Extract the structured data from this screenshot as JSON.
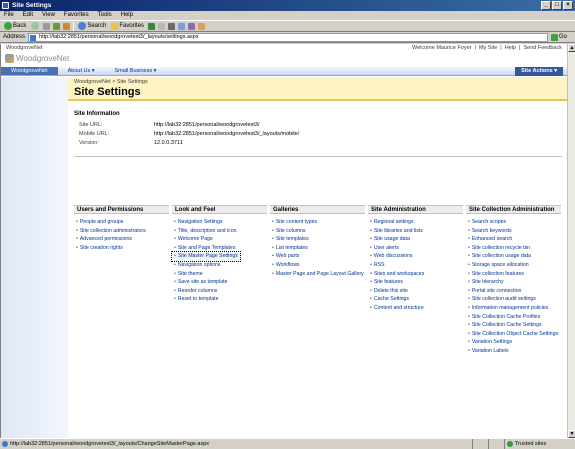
{
  "window": {
    "title": "Site Settings"
  },
  "menu": [
    "File",
    "Edit",
    "View",
    "Favorites",
    "Tools",
    "Help"
  ],
  "toolbar": {
    "back": "Back",
    "search": "Search",
    "favorites": "Favorites"
  },
  "address": {
    "label": "Address",
    "url": "http://lab32:2851/personal/woodgrovetest3/_layouts/settings.aspx",
    "go": "Go"
  },
  "sp": {
    "site_name": "WoodgroveNet",
    "welcome": "Welcome Maurice Foyer",
    "top_links": [
      "My Site",
      "Help",
      "Send Feedback"
    ],
    "logo_text": "WoodgroveNet",
    "tabs": [
      {
        "label": "WoodgroveNet"
      },
      {
        "label": "About Us"
      },
      {
        "label": "Small Business"
      }
    ],
    "site_actions": "Site Actions",
    "breadcrumb": "WoodgroveNet > Site Settings",
    "page_title": "Site Settings"
  },
  "site_info": {
    "heading": "Site Information",
    "rows": [
      {
        "k": "Site URL:",
        "v": "http://lab32:2851/personal/woodgrovetest3/"
      },
      {
        "k": "Mobile URL:",
        "v": "http://lab32:2851/personal/woodgrovetest3/_layouts/mobile/"
      },
      {
        "k": "Version:",
        "v": "12.0.0.3711"
      }
    ]
  },
  "columns": [
    {
      "heading": "Users and Permissions",
      "links": [
        "People and groups",
        "Site collection administrators",
        "Advanced permissions",
        "Site creation rights"
      ]
    },
    {
      "heading": "Look and Feel",
      "links": [
        "Navigation Settings",
        "Title, description and icon",
        "Welcome Page",
        "Site and Page Templates",
        "Site Master Page Settings",
        "Navigation options",
        "Site theme",
        "Save site as template",
        "Reorder columns",
        "Reset to template"
      ]
    },
    {
      "heading": "Galleries",
      "links": [
        "Site content types",
        "Site columns",
        "Site templates",
        "List templates",
        "Web parts",
        "Workflows",
        "Master Page and Page Layout Gallery"
      ]
    },
    {
      "heading": "Site Administration",
      "links": [
        "Regional settings",
        "Site libraries and lists",
        "Site usage data",
        "User alerts",
        "Web discussions",
        "RSS",
        "Sites and workspaces",
        "Site features",
        "Delete this site",
        "Cache Settings",
        "Content and structure"
      ]
    },
    {
      "heading": "Site Collection Administration",
      "links": [
        "Search scopes",
        "Search keywords",
        "Enhanced search",
        "Site collection recycle bin",
        "Site collection usage data",
        "Storage space allocation",
        "Site collection features",
        "Site hierarchy",
        "Portal site connection",
        "Site collection audit settings",
        "Information management policies",
        "Site Collection Cache Profiles",
        "Site Collection Cache Settings",
        "Site Collection Object Cache Settings",
        "Variation Settings",
        "Variation Labels"
      ]
    }
  ],
  "status": {
    "url": "http://lab32:2851/personal/woodgrovetest3/_layouts/ChangeSiteMasterPage.aspx",
    "zone": "Trusted sites"
  }
}
